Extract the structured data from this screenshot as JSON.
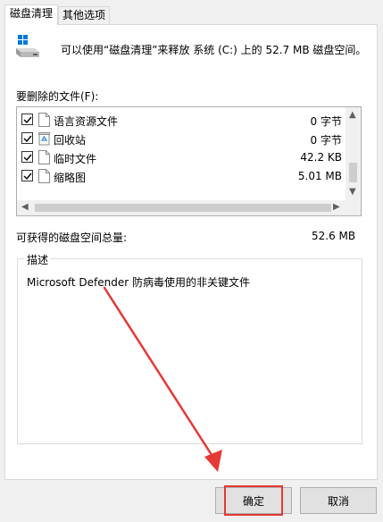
{
  "tabs": [
    {
      "label": "磁盘清理",
      "active": true
    },
    {
      "label": "其他选项",
      "active": false
    }
  ],
  "summary_text": "可以使用“磁盘清理”来释放 系统 (C:) 上的 52.7 MB 磁盘空间。",
  "files_label": "要删除的文件(F):",
  "file_list": [
    {
      "name": "语言资源文件",
      "size": "0 字节",
      "checked": true,
      "icon": "document-icon"
    },
    {
      "name": "回收站",
      "size": "0 字节",
      "checked": true,
      "icon": "recycle-bin-icon"
    },
    {
      "name": "临时文件",
      "size": "42.2 KB",
      "checked": true,
      "icon": "document-icon"
    },
    {
      "name": "缩略图",
      "size": "5.01 MB",
      "checked": true,
      "icon": "document-icon"
    }
  ],
  "total_label": "可获得的磁盘空间总量:",
  "total_value": "52.6 MB",
  "description_title": "描述",
  "description_text": "Microsoft Defender 防病毒使用的非关键文件",
  "buttons": {
    "ok": "确定",
    "cancel": "取消"
  },
  "colors": {
    "annotation": "#e53935",
    "accent": "#0078d7"
  }
}
